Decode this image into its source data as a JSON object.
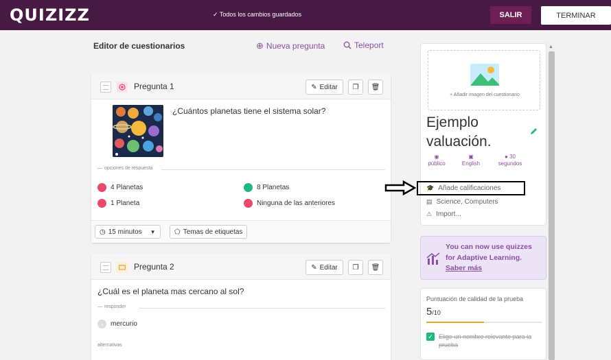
{
  "header": {
    "logo": "QUIZIZZ",
    "saved_status": "✓ Todos los cambios guardados",
    "exit_label": "SALIR",
    "finish_label": "TERMINAR"
  },
  "editor": {
    "title": "Editor de cuestionarios",
    "new_question": "Nueva pregunta",
    "teleport": "Teleport"
  },
  "questions": [
    {
      "title": "Pregunta 1",
      "edit_label": "Editar",
      "text": "¿Cuántos planetas tiene el sistema solar?",
      "answers_label": "opciones de respuesta",
      "options": [
        {
          "text": "4 Planetas",
          "color": "#e94a6b"
        },
        {
          "text": "8 Planetas",
          "color": "#1fb87e"
        },
        {
          "text": "1 Planeta",
          "color": "#e94a6b"
        },
        {
          "text": "Ninguna de las anteriores",
          "color": "#e94a6b"
        }
      ],
      "time": "15 minutos",
      "tags": "Temas de etiquetas"
    },
    {
      "title": "Pregunta 2",
      "edit_label": "Editar",
      "text": "¿Cuál es el planeta mas cercano al sol?",
      "answer_label": "responder",
      "answer": "mercurio",
      "alternatives_label": "alternativas"
    }
  ],
  "sidebar": {
    "add_image": "+ Añadir imagen del cuestionario",
    "quiz_name": "Ejemplo valuación.",
    "visibility": "público",
    "language": "English",
    "time_value": "30",
    "time_unit": "segundos",
    "add_grades": "Añade calificaciones",
    "subjects": "Science, Computers",
    "import": "Import..."
  },
  "promo": {
    "text": "You can now use quizzes for Adaptive Learning.",
    "link": "Saber más"
  },
  "quality": {
    "title": "Puntuación de calidad de la prueba",
    "score": "5",
    "score_max": "/10",
    "progress": 0.5,
    "item": "Elige un nombre relevante para la prueba"
  },
  "colors": {
    "brand": "#461a42",
    "accent": "#8c4fa0",
    "progress": "#f0a32c"
  }
}
